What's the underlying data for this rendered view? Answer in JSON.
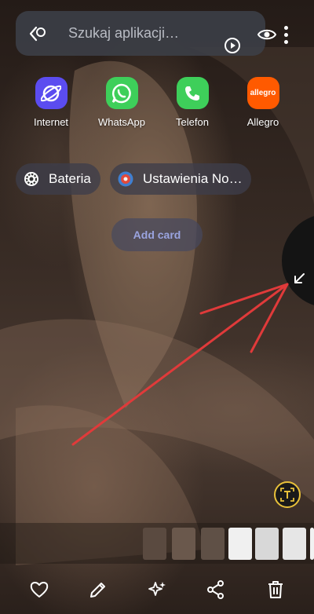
{
  "search": {
    "placeholder": "Szukaj aplikacji…"
  },
  "apps": [
    {
      "label": "Internet",
      "icon": "internet-icon",
      "color": "#5b4cf0"
    },
    {
      "label": "WhatsApp",
      "icon": "whatsapp-icon",
      "color": "#3ecf5a"
    },
    {
      "label": "Telefon",
      "icon": "phone-icon",
      "color": "#3ecf5a"
    },
    {
      "label": "Allegro",
      "icon": "allegro-icon",
      "color": "#ff5a00",
      "icon_text": "allegro"
    }
  ],
  "shortcuts": [
    {
      "label": "Bateria",
      "icon": "battery-settings-icon"
    },
    {
      "label": "Ustawienia No…",
      "icon": "notification-settings-icon"
    }
  ],
  "add_card_label": "Add card",
  "colors": {
    "accent_blue": "#9aa4e0",
    "arrow_red": "#e03a3a",
    "scan_ring": "#e8c13a"
  },
  "toolbar": {
    "buttons": [
      "heart-icon",
      "pencil-icon",
      "sparkle-icon",
      "share-icon",
      "trash-icon"
    ]
  }
}
